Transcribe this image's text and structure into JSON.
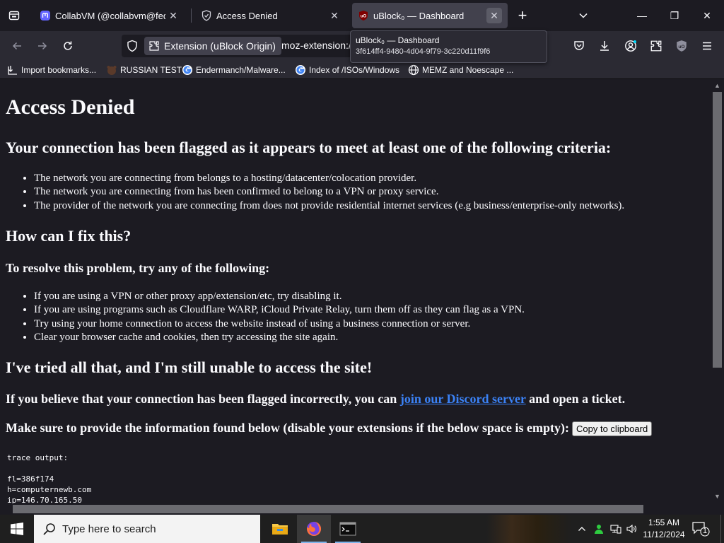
{
  "tabs": [
    {
      "title": "CollabVM (@collabvm@fedi.co",
      "icon": "mastodon-icon",
      "active": false
    },
    {
      "title": "Access Denied",
      "icon": "cloudflare-shield-icon",
      "active": false
    },
    {
      "title": "uBlock₀ — Dashboard",
      "icon": "ublock-icon",
      "active": true
    }
  ],
  "tab_close_glyph": "✕",
  "new_tab_glyph": "+",
  "window": {
    "minimize": "—",
    "maximize": "❐",
    "close": "✕"
  },
  "urlbar": {
    "identity_label": "Extension (uBlock Origin)",
    "url": "moz-extension://"
  },
  "tooltip": {
    "title": "uBlock₀ — Dashboard",
    "subtitle": "3f614ff4-9480-4d04-9f79-3c220d11f9f6"
  },
  "bookmarks": [
    {
      "label": "Import bookmarks...",
      "icon": "import-icon"
    },
    {
      "label": "RUSSIAN TEST",
      "icon": "bear-icon"
    },
    {
      "label": "Endermanch/Malware...",
      "icon": "google-icon"
    },
    {
      "label": "Index of /ISOs/Windows",
      "icon": "google-icon"
    },
    {
      "label": "MEMZ and Noescape ...",
      "icon": "globe-icon"
    }
  ],
  "page": {
    "title": "Access Denied",
    "criteria_heading": "Your connection has been flagged as it appears to meet at least one of the following criteria:",
    "criteria": [
      "The network you are connecting from belongs to a hosting/datacenter/colocation provider.",
      "The network you are connecting from has been confirmed to belong to a VPN or proxy service.",
      "The provider of the network you are connecting from does not provide residential internet services (e.g business/enterprise-only networks)."
    ],
    "fix_heading": "How can I fix this?",
    "resolve_heading": "To resolve this problem, try any of the following:",
    "fixes": [
      "If you are using a VPN or other proxy app/extension/etc, try disabling it.",
      "If you are using programs such as Cloudflare WARP, iCloud Private Relay, turn them off as they can flag as a VPN.",
      "Try using your home connection to access the website instead of using a business connection or server.",
      "Clear your browser cache and cookies, then try accessing the site again."
    ],
    "still_heading": "I've tried all that, and I'm still unable to access the site!",
    "discord_pre": "If you believe that your connection has been flagged incorrectly, you can ",
    "discord_link": "join our Discord server",
    "discord_post": " and open a ticket.",
    "info_text": "Make sure to provide the information found below (disable your extensions if the below space is empty):",
    "copy_button": "Copy to clipboard",
    "trace": "trace output:\n\nfl=386f174\nh=computernewb.com\nip=146.70.165.50"
  },
  "taskbar": {
    "search_placeholder": "Type here to search",
    "time": "1:55 AM",
    "date": "11/12/2024",
    "notification_count": "1"
  }
}
